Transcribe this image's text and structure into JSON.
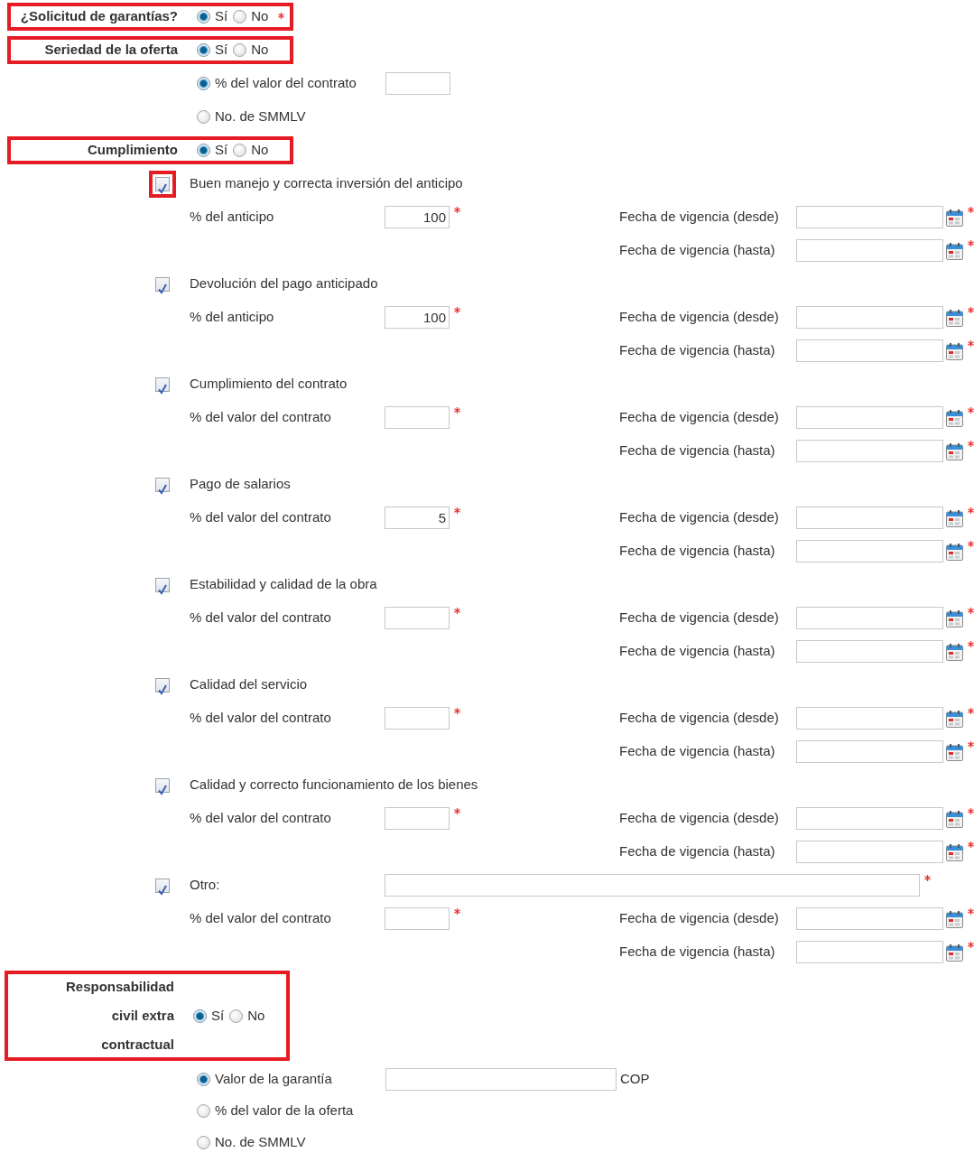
{
  "guarantee_request": {
    "label": "¿Solicitud de garantías?",
    "required": true,
    "highlighted": true,
    "options": [
      {
        "label": "Sí",
        "selected": true
      },
      {
        "label": "No",
        "selected": false
      }
    ]
  },
  "bid_seriousness": {
    "label": "Seriedad de la oferta",
    "highlighted": true,
    "options": [
      {
        "label": "Sí",
        "selected": true
      },
      {
        "label": "No",
        "selected": false
      }
    ],
    "sub_options": [
      {
        "label": "% del valor del contrato",
        "selected": true,
        "kind": "with_field"
      },
      {
        "label": "No. de SMMLV",
        "selected": false,
        "kind": "plain"
      }
    ]
  },
  "compliance": {
    "label": "Cumplimiento",
    "highlighted": true,
    "options": [
      {
        "label": "Sí",
        "selected": true
      },
      {
        "label": "No",
        "selected": false
      }
    ],
    "items": [
      {
        "label": "Buen manejo y correcta inversión del anticipo",
        "checked": true,
        "highlighted": true,
        "kind": "standard",
        "amount_label": "% del anticipo",
        "amount": "100",
        "required": true,
        "dates": [
          {
            "label": "Fecha de vigencia (desde)",
            "required": true
          },
          {
            "label": "Fecha de vigencia (hasta)",
            "required": true
          }
        ]
      },
      {
        "label": "Devolución del pago anticipado",
        "checked": true,
        "highlighted": false,
        "kind": "standard",
        "amount_label": "% del anticipo",
        "amount": "100",
        "required": true,
        "dates": [
          {
            "label": "Fecha de vigencia (desde)",
            "required": true
          },
          {
            "label": "Fecha de vigencia (hasta)",
            "required": true
          }
        ]
      },
      {
        "label": "Cumplimiento del contrato",
        "checked": true,
        "highlighted": false,
        "kind": "standard",
        "amount_label": "% del valor del contrato",
        "required": true,
        "dates": [
          {
            "label": "Fecha de vigencia (desde)",
            "required": true
          },
          {
            "label": "Fecha de vigencia (hasta)",
            "required": true
          }
        ]
      },
      {
        "label": "Pago de salarios",
        "checked": true,
        "highlighted": false,
        "kind": "standard",
        "amount_label": "% del valor del contrato",
        "amount": "5",
        "required": true,
        "dates": [
          {
            "label": "Fecha de vigencia (desde)",
            "required": true
          },
          {
            "label": "Fecha de vigencia (hasta)",
            "required": true
          }
        ]
      },
      {
        "label": "Estabilidad y calidad de la obra",
        "checked": true,
        "highlighted": false,
        "kind": "standard",
        "amount_label": "% del valor del contrato",
        "required": true,
        "dates": [
          {
            "label": "Fecha de vigencia (desde)",
            "required": true
          },
          {
            "label": "Fecha de vigencia (hasta)",
            "required": true
          }
        ]
      },
      {
        "label": "Calidad del servicio",
        "checked": true,
        "highlighted": false,
        "kind": "standard",
        "amount_label": "% del valor del contrato",
        "required": true,
        "dates": [
          {
            "label": "Fecha de vigencia (desde)",
            "required": true
          },
          {
            "label": "Fecha de vigencia (hasta)",
            "required": true
          }
        ]
      },
      {
        "label": "Calidad y correcto funcionamiento de los bienes",
        "checked": true,
        "highlighted": false,
        "kind": "standard",
        "amount_label": "% del valor del contrato",
        "required": true,
        "dates": [
          {
            "label": "Fecha de vigencia (desde)",
            "required": true
          },
          {
            "label": "Fecha de vigencia (hasta)",
            "required": true
          }
        ]
      },
      {
        "label": "Otro:",
        "checked": true,
        "highlighted": false,
        "kind": "other",
        "detail_required": true,
        "amount_label": "% del valor del contrato",
        "required": true,
        "dates": [
          {
            "label": "Fecha de vigencia (desde)",
            "required": true
          },
          {
            "label": "Fecha de vigencia (hasta)",
            "required": true
          }
        ]
      }
    ]
  },
  "liability": {
    "label": "Responsabilidad civil extra contractual",
    "highlighted": true,
    "options": [
      {
        "label": "Sí",
        "selected": true
      },
      {
        "label": "No",
        "selected": false
      }
    ],
    "sub_options": [
      {
        "label": "Valor de la garantía",
        "selected": true,
        "kind": "with_field",
        "unit": "COP"
      },
      {
        "label": "% del valor de la oferta",
        "selected": false,
        "kind": "plain"
      },
      {
        "label": "No. de SMMLV",
        "selected": false,
        "kind": "plain"
      }
    ]
  }
}
